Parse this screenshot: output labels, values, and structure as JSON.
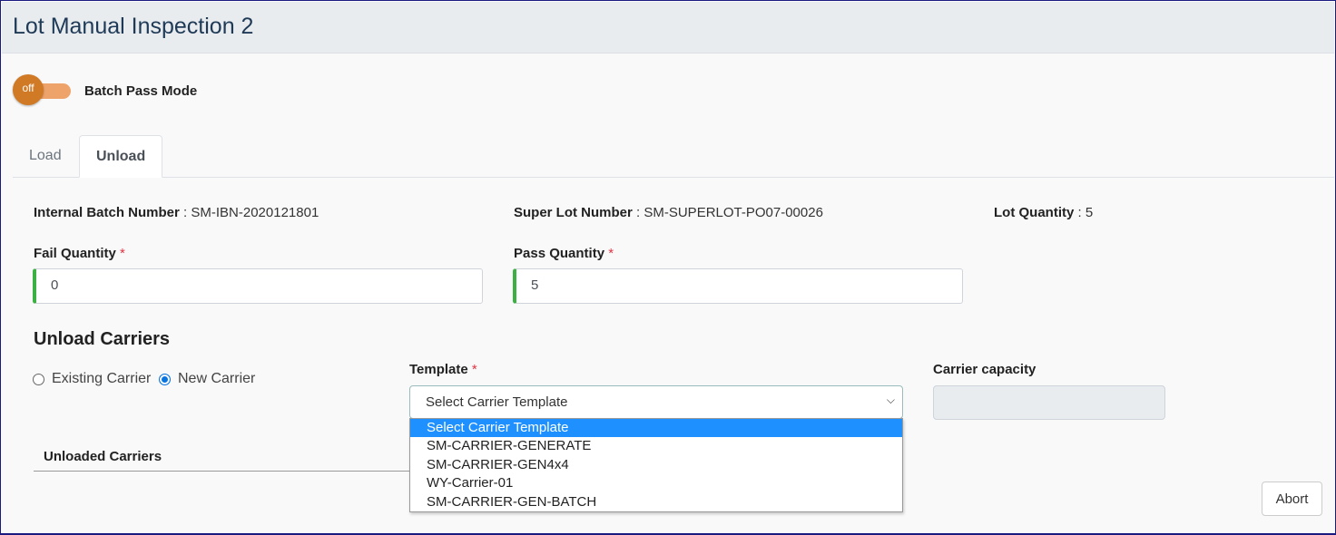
{
  "header": {
    "title": "Lot Manual Inspection 2"
  },
  "batch_pass": {
    "toggle_text": "off",
    "label": "Batch Pass Mode"
  },
  "tabs": [
    {
      "label": "Load"
    },
    {
      "label": "Unload"
    }
  ],
  "info": {
    "internal_batch_label": "Internal Batch Number",
    "internal_batch_value": ": SM-IBN-2020121801",
    "super_lot_label": "Super Lot Number",
    "super_lot_value": ": SM-SUPERLOT-PO07-00026",
    "lot_qty_label": "Lot Quantity",
    "lot_qty_value": ": 5"
  },
  "form": {
    "fail_label": "Fail Quantity",
    "fail_value": "0",
    "pass_label": "Pass Quantity",
    "pass_value": "5",
    "required": "*"
  },
  "carriers": {
    "heading": "Unload Carriers",
    "existing": "Existing Carrier",
    "new": "New Carrier",
    "template_label": "Template",
    "template_selected": "Select Carrier Template",
    "template_options": [
      "Select Carrier Template",
      "SM-CARRIER-GENERATE",
      "SM-CARRIER-GEN4x4",
      "WY-Carrier-01",
      "SM-CARRIER-GEN-BATCH"
    ],
    "capacity_label": "Carrier capacity",
    "unloaded_label": "Unloaded Carriers"
  },
  "actions": {
    "abort": "Abort"
  }
}
